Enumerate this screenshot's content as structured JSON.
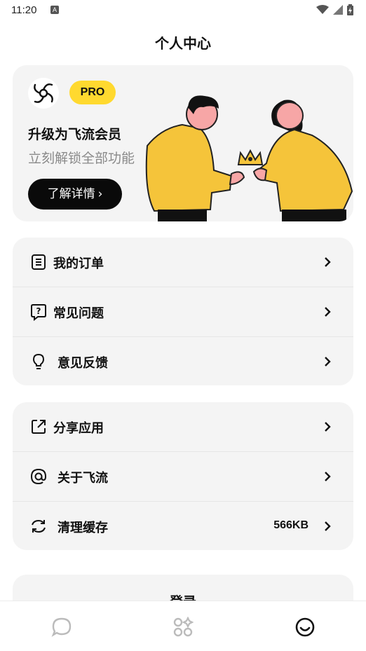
{
  "status": {
    "time": "11:20",
    "a_icon": "A"
  },
  "page": {
    "title": "个人中心"
  },
  "promo": {
    "badge": "PRO",
    "title": "升级为飞流会员",
    "subtitle": "立刻解锁全部功能",
    "button_label": "了解详情",
    "accent_color": "#ffd92f"
  },
  "menu_group_1": [
    {
      "label": "我的订单",
      "icon": "order-list-icon"
    },
    {
      "label": "常见问题",
      "icon": "question-icon"
    },
    {
      "label": "意见反馈",
      "icon": "lightbulb-icon"
    }
  ],
  "menu_group_2": [
    {
      "label": "分享应用",
      "icon": "share-icon"
    },
    {
      "label": "关于飞流",
      "icon": "at-icon"
    },
    {
      "label": "清理缓存",
      "icon": "refresh-icon",
      "value": "566KB"
    }
  ],
  "login": {
    "label": "登录"
  },
  "tabs": [
    {
      "name": "chat",
      "icon": "chat-bubble-icon"
    },
    {
      "name": "apps",
      "icon": "apps-grid-icon"
    },
    {
      "name": "profile",
      "icon": "smiley-icon",
      "active": true
    }
  ]
}
